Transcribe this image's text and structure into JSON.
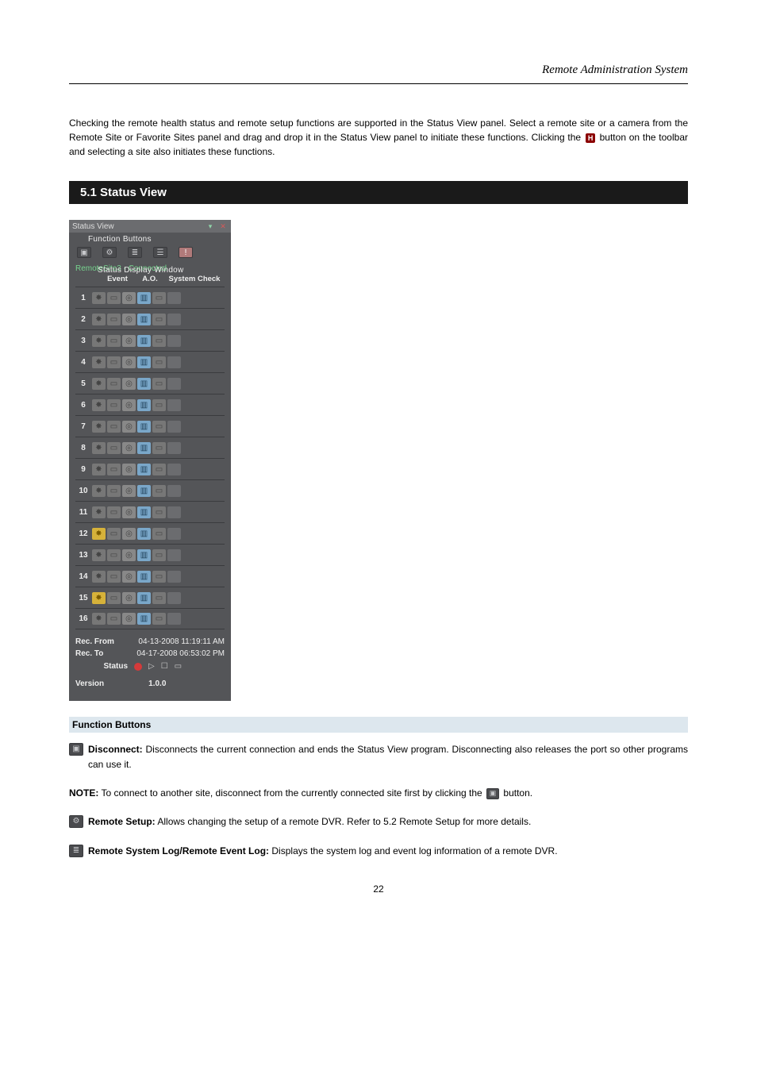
{
  "doc_title": "Remote Administration System",
  "intro": {
    "pre": "Checking the remote health status and remote setup functions are supported in the Status View panel. Select a remote site or a camera from the Remote Site or Favorite Sites panel and drag and drop it in the Status View panel to initiate these functions. Clicking the ",
    "post": " button on the toolbar and selecting a site also initiates these functions."
  },
  "section_title": "5.1 Status View",
  "sv": {
    "title": "Status View",
    "fn_label": "Function Buttons",
    "site_line": "RemoteSite3 - Connected",
    "sd_label": "Status Display Window",
    "headers": {
      "event": "Event",
      "ao": "A.O.",
      "sys": "System Check"
    },
    "rows_on": [
      12,
      15
    ],
    "rec_from_l": "Rec. From",
    "rec_from_v": "04-13-2008 11:19:11 AM",
    "rec_to_l": "Rec. To",
    "rec_to_v": "04-17-2008 06:53:02 PM",
    "status_l": "Status",
    "version_l": "Version",
    "version_v": "1.0.0"
  },
  "fb_header": "Function Buttons",
  "fb": {
    "disconnect": {
      "head": "Disconnect:",
      "body": " Disconnects the current connection and ends the Status View program. Disconnecting also releases the port so other programs can use it."
    },
    "note": {
      "pre": "NOTE: To connect to another site, disconnect from the currently connected site first by clicking the ",
      "post": " button."
    },
    "remote_setup": {
      "head": "Remote Setup:",
      "body": " Allows changing the setup of a remote DVR. Refer to ",
      "link": "5.2 Remote Setup",
      "tail": " for more details."
    },
    "remote_log": {
      "head": "Remote System Log/Remote Event Log:",
      "body": " Displays the system log and event log information of a remote DVR."
    }
  },
  "page_number": "22"
}
